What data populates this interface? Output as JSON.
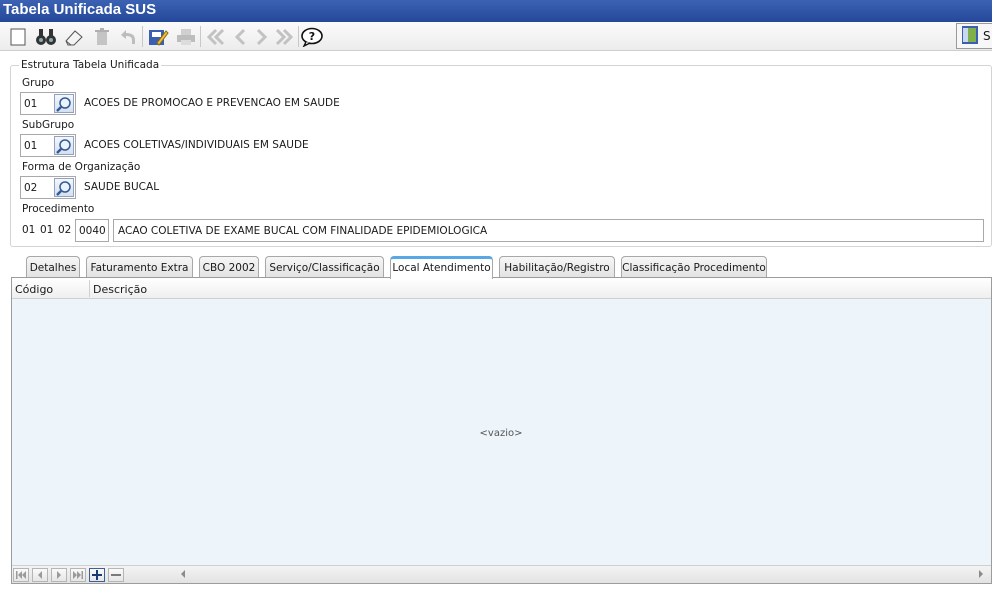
{
  "window": {
    "title": "Tabela Unificada SUS"
  },
  "toolbar": {
    "buttons": [
      "new-icon",
      "search-binoculars-icon",
      "eraser-icon",
      "trash-icon",
      "undo-icon",
      "save-edit-icon",
      "print-icon",
      "first-icon",
      "previous-icon",
      "next-icon",
      "last-icon",
      "help-icon"
    ],
    "right_label": "S"
  },
  "estrutura": {
    "legend": "Estrutura Tabela Unificada",
    "grupo": {
      "label": "Grupo",
      "code": "01",
      "description": "ACOES DE PROMOCAO E PREVENCAO EM SAUDE"
    },
    "subgrupo": {
      "label": "SubGrupo",
      "code": "01",
      "description": "ACOES COLETIVAS/INDIVIDUAIS EM SAUDE"
    },
    "forma": {
      "label": "Forma de Organização",
      "code": "02",
      "description": "SAUDE BUCAL"
    },
    "procedimento": {
      "label": "Procedimento",
      "grupo": "01",
      "subgrupo": "01",
      "forma": "02",
      "code": "0040",
      "description": "ACAO COLETIVA DE EXAME BUCAL COM FINALIDADE EPIDEMIOLOGICA"
    }
  },
  "tabs": [
    {
      "label": "Detalhes"
    },
    {
      "label": "Faturamento Extra"
    },
    {
      "label": "CBO 2002"
    },
    {
      "label": "Serviço/Classificação"
    },
    {
      "label": "Local Atendimento",
      "active": true
    },
    {
      "label": "Habilitação/Registro"
    },
    {
      "label": "Classificação Procedimento"
    }
  ],
  "grid": {
    "columns": [
      "Código",
      "Descrição"
    ],
    "empty_text": "<vazio>"
  },
  "colors": {
    "title_bar": "#2d52a6",
    "active_tab_accent": "#5aa7e6",
    "grid_background": "#edf4fa"
  }
}
